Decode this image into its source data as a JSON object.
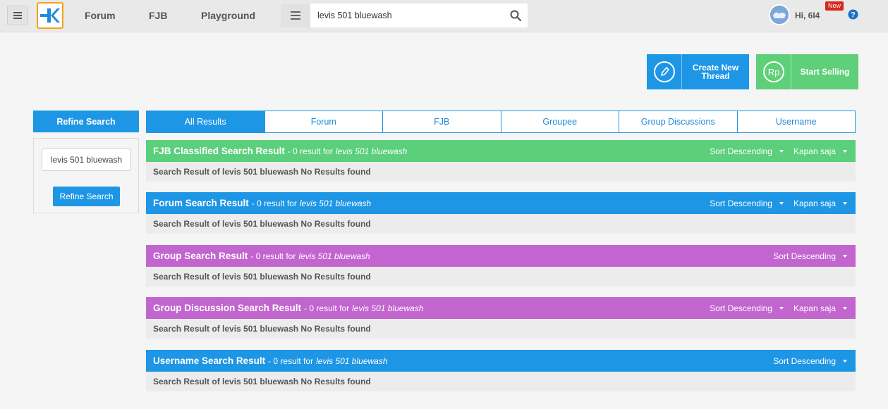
{
  "header": {
    "nav": [
      "Forum",
      "FJB",
      "Playground"
    ],
    "search": {
      "value": "levis 501 bluewash"
    },
    "greeting": "Hi, 6I4",
    "new_badge": "New"
  },
  "actions": {
    "create_thread": "Create New Thread",
    "start_selling": "Start Selling"
  },
  "refine": {
    "title": "Refine Search",
    "input_value": "levis 501 bluewash",
    "button": "Refine Search"
  },
  "tabs": [
    "All Results",
    "Forum",
    "FJB",
    "Groupee",
    "Group Discussions",
    "Username"
  ],
  "sections": [
    {
      "title": "FJB Classified Search Result",
      "count": "- 0 result for",
      "query": "levis 501 bluewash",
      "sort": "Sort Descending",
      "time": "Kapan saja",
      "body": "Search Result of levis 501 bluewash No Results found",
      "color": "#5bcf7b"
    },
    {
      "title": "Forum Search Result",
      "count": "- 0 result for",
      "query": "levis 501 bluewash",
      "sort": "Sort Descending",
      "time": "Kapan saja",
      "body": "Search Result of levis 501 bluewash No Results found",
      "color": "#1e96e6"
    },
    {
      "title": "Group Search Result",
      "count": "- 0 result for",
      "query": "levis 501 bluewash",
      "sort": "Sort Descending",
      "body": "Search Result of levis 501 bluewash No Results found",
      "color": "#c265cf"
    },
    {
      "title": "Group Discussion Search Result",
      "count": "- 0 result for",
      "query": "levis 501 bluewash",
      "sort": "Sort Descending",
      "time": "Kapan saja",
      "body": "Search Result of levis 501 bluewash No Results found",
      "color": "#c265cf"
    },
    {
      "title": "Username Search Result",
      "count": "- 0 result for",
      "query": "levis 501 bluewash",
      "sort": "Sort Descending",
      "body": "Search Result of levis 501 bluewash No Results found",
      "color": "#1e96e6"
    }
  ]
}
